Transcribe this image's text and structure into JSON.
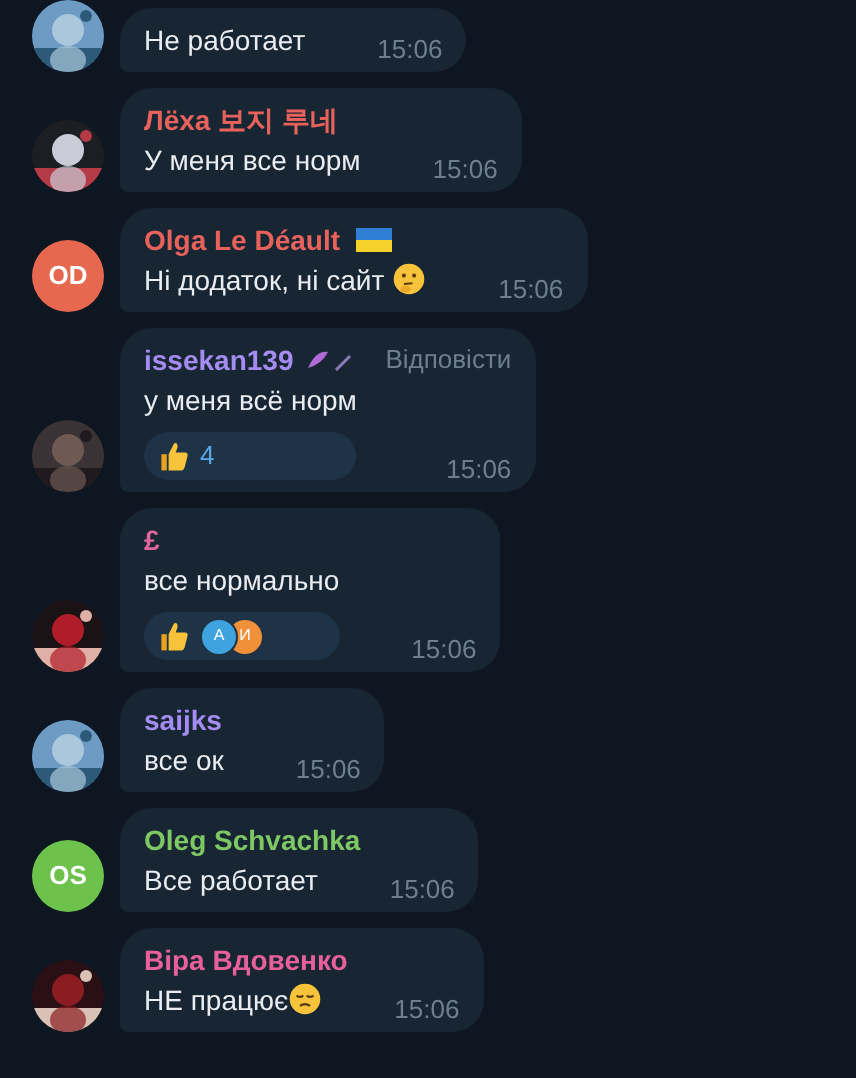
{
  "messages": [
    {
      "text": "Не работает",
      "time": "15:06"
    },
    {
      "author": "Лёха 보지 루네",
      "color": "#e8625c",
      "text": "У меня все норм",
      "time": "15:06"
    },
    {
      "author": "Olga Le Déault",
      "color": "#e8625c",
      "author_badge": {
        "kind": "flag"
      },
      "text": "Ні додаток, ні сайт",
      "text_emoji": {
        "kind": "thinking"
      },
      "time": "15:06",
      "avatar": {
        "kind": "initials",
        "initials": "OD",
        "color": "#e5684f"
      }
    },
    {
      "author": "issekan139",
      "color": "#a48cf0",
      "author_badge": {
        "kind": "feather"
      },
      "reply": "Відповісти",
      "text": "у меня всё норм",
      "time": "15:06",
      "reaction": {
        "kind": "count",
        "count": "4",
        "chosen": false
      }
    },
    {
      "author": "£",
      "color": "#e0679c",
      "text": "все нормально",
      "time": "15:06",
      "reaction": {
        "kind": "users",
        "users": [
          {
            "initial": "А",
            "color": "#3fa3e0"
          },
          {
            "initial": "И",
            "color": "#f0913a"
          }
        ]
      }
    },
    {
      "author": "saijks",
      "color": "#a48cf0",
      "text": "все ок",
      "time": "15:06"
    },
    {
      "author": "Oleg Schvachka",
      "color": "#7ec864",
      "text": "Все работает",
      "time": "15:06",
      "avatar": {
        "kind": "initials",
        "initials": "OS",
        "color": "#6cc24a"
      }
    },
    {
      "author": "Віра Вдовенко",
      "color": "#e8609a",
      "text": "НЕ працює",
      "text_emoji": {
        "kind": "sad"
      },
      "time": "15:06"
    }
  ]
}
